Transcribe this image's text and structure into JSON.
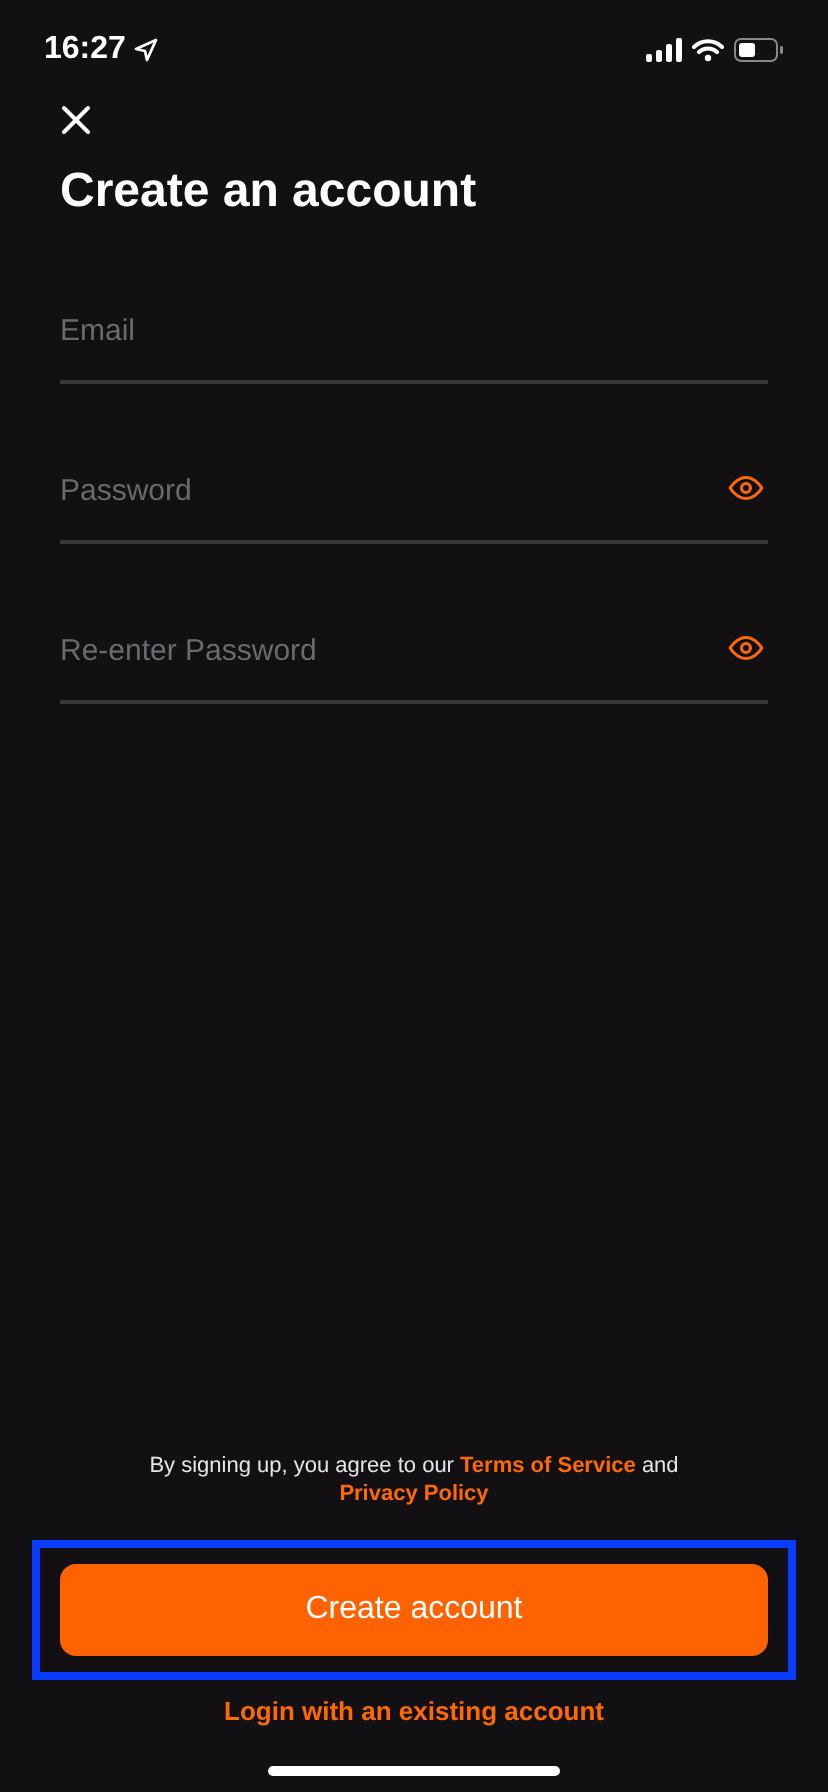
{
  "status_bar": {
    "time": "16:27"
  },
  "title": "Create an account",
  "fields": [
    {
      "placeholder": "Email",
      "visibility_toggle": false
    },
    {
      "placeholder": "Password",
      "visibility_toggle": true
    },
    {
      "placeholder": "Re-enter Password",
      "visibility_toggle": true
    }
  ],
  "terms": {
    "prefix": "By signing up, you agree to our",
    "terms_link": "Terms of Service",
    "joiner": "and",
    "privacy_link": "Privacy Policy"
  },
  "primary_button": {
    "label": "Create account",
    "highlighted": true
  },
  "login_link": "Login with an existing account"
}
